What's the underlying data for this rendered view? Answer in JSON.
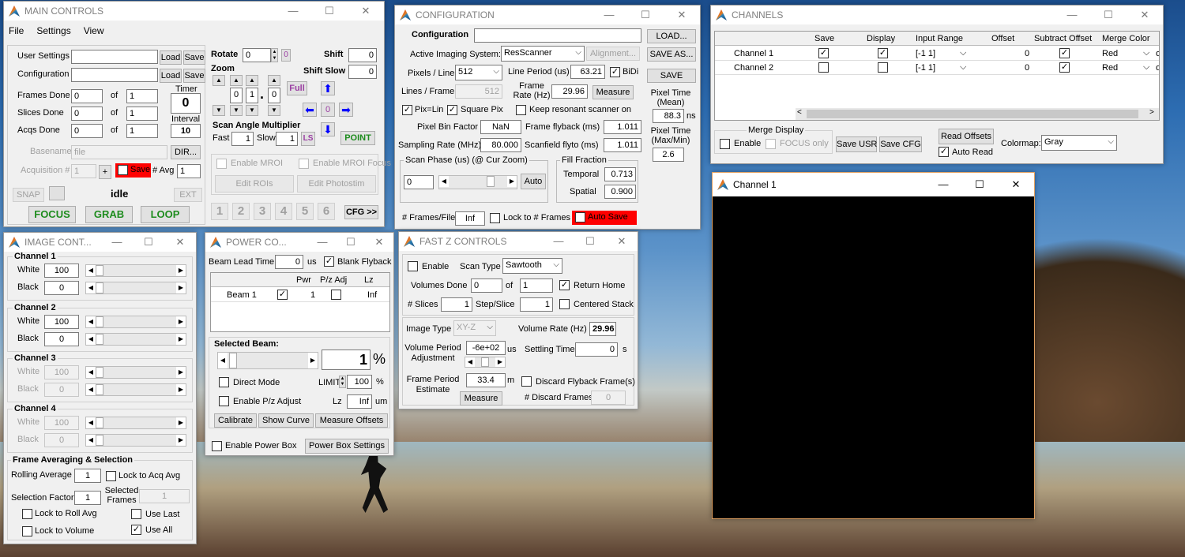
{
  "main": {
    "title": "MAIN CONTROLS",
    "menu": [
      "File",
      "Settings",
      "View"
    ],
    "user_settings": "User Settings",
    "configuration": "Configuration",
    "load": "Load",
    "save": "Save",
    "frames_done": "Frames Done",
    "slices_done": "Slices Done",
    "acqs_done": "Acqs Done",
    "of": "of",
    "frames_val": "0",
    "frames_of": "1",
    "slices_val": "0",
    "slices_of": "1",
    "acqs_val": "0",
    "acqs_of": "1",
    "timer": "Timer",
    "timer_val": "0",
    "interval": "Interval",
    "interval_val": "10",
    "basename": "Basename",
    "basename_val": "file",
    "dir": "DIR...",
    "acq_num": "Acquisition #",
    "acq_num_val": "1",
    "plus": "+",
    "save_red": "Save",
    "avg": "# Avg",
    "avg_val": "1",
    "snap": "SNAP",
    "status": "idle",
    "ext": "EXT",
    "focus": "FOCUS",
    "grab": "GRAB",
    "loop": "LOOP",
    "rotate": "Rotate",
    "rotate_val": "0",
    "zero": "0",
    "zoom": "Zoom",
    "shift": "Shift",
    "shift_val": "0",
    "shift_slow": "Shift Slow",
    "shift_slow_val": "0",
    "zoom_d1": "0",
    "zoom_d2": "1",
    "zoom_dot": ".",
    "zoom_d3": "0",
    "full": "Full",
    "center": "0",
    "scan_angle": "Scan Angle Multiplier",
    "fast": "Fast",
    "fast_val": "1",
    "slow": "Slow",
    "slow_val": "1",
    "ls": "LS",
    "point": "POINT",
    "enable_mroi": "Enable MROI",
    "enable_mroi_focus": "Enable MROI Focus",
    "edit_rois": "Edit ROIs",
    "edit_photostim": "Edit Photostim",
    "nums": [
      "1",
      "2",
      "3",
      "4",
      "5",
      "6"
    ],
    "cfg": "CFG >>"
  },
  "config": {
    "title": "CONFIGURATION",
    "configuration": "Configuration",
    "load": "LOAD...",
    "save_as": "SAVE AS...",
    "save": "SAVE",
    "active_sys": "Active Imaging System:",
    "active_sys_val": "ResScanner",
    "alignment": "Alignment...",
    "pixels_line": "Pixels / Line",
    "pixels_line_val": "512",
    "line_period": "Line Period (us)",
    "line_period_val": "63.21",
    "bidi": "BiDi",
    "lines_frame": "Lines / Frame",
    "lines_frame_val": "512",
    "frame_rate": "Frame Rate (Hz)",
    "frame_rate_val": "29.96",
    "measure": "Measure",
    "pixlin": "Pix=Lin",
    "square": "Square Pix",
    "keep_res": "Keep resonant scanner on",
    "pixel_time_mean": "Pixel Time (Mean)",
    "pixel_time_mean_val": "88.3",
    "ns": "ns",
    "pixel_time_maxmin": "Pixel Time (Max/Min)",
    "pixel_time_maxmin_val": "2.6",
    "pixel_bin": "Pixel Bin Factor",
    "pixel_bin_val": "NaN",
    "frame_flyback": "Frame flyback (ms)",
    "frame_flyback_val": "1.011",
    "sampling": "Sampling Rate (MHz)",
    "sampling_val": "80.000",
    "scanfield": "Scanfield flyto (ms)",
    "scanfield_val": "1.011",
    "scan_phase": "Scan Phase (us) (@ Cur Zoom)",
    "scan_phase_val": "0",
    "auto": "Auto",
    "fill_fraction": "Fill Fraction",
    "temporal": "Temporal",
    "temporal_val": "0.713",
    "spatial": "Spatial",
    "spatial_val": "0.900",
    "frames_file": "# Frames/File",
    "frames_file_val": "Inf",
    "lock_frames": "Lock to # Frames",
    "auto_save": "Auto Save"
  },
  "channels": {
    "title": "CHANNELS",
    "headers": [
      "Save",
      "Display",
      "Input Range",
      "Offset",
      "Subtract Offset",
      "Merge Color"
    ],
    "rows": [
      {
        "name": "Channel 1",
        "save": true,
        "display": true,
        "range": "[-1 1]",
        "offset": "0",
        "subtract": true,
        "color": "Red"
      },
      {
        "name": "Channel 2",
        "save": false,
        "display": false,
        "range": "[-1 1]",
        "offset": "0",
        "subtract": true,
        "color": "Red"
      }
    ],
    "merge_display": "Merge Display",
    "enable": "Enable",
    "focus_only": "FOCUS only",
    "save_usr": "Save USR",
    "save_cfg": "Save CFG",
    "read_offsets": "Read Offsets",
    "auto_read": "Auto Read",
    "colormap": "Colormap:",
    "colormap_val": "Gray",
    "overflow": "o"
  },
  "ch1win": {
    "title": "Channel 1"
  },
  "image": {
    "title": "IMAGE CONT...",
    "white": "White",
    "black": "Black",
    "channels": [
      {
        "name": "Channel 1",
        "white": "100",
        "black": "0",
        "enabled": true
      },
      {
        "name": "Channel 2",
        "white": "100",
        "black": "0",
        "enabled": true
      },
      {
        "name": "Channel 3",
        "white": "100",
        "black": "0",
        "enabled": false
      },
      {
        "name": "Channel 4",
        "white": "100",
        "black": "0",
        "enabled": false
      }
    ],
    "frame_avg": "Frame Averaging & Selection",
    "rolling": "Rolling Average",
    "rolling_val": "1",
    "lock_acq": "Lock to Acq Avg",
    "sel_factor": "Selection Factor",
    "sel_factor_val": "1",
    "sel_frames": "Selected Frames",
    "sel_frames_val": "1",
    "lock_roll": "Lock to Roll Avg",
    "use_last": "Use Last",
    "lock_vol": "Lock to Volume",
    "use_all": "Use All"
  },
  "power": {
    "title": "POWER CO...",
    "beam_lead": "Beam Lead Time:",
    "beam_lead_val": "0",
    "us": "us",
    "blank_flyback": "Blank Flyback",
    "headers": [
      "Pwr",
      "P/z Adj",
      "Lz"
    ],
    "beam": "Beam 1",
    "beam_pwr": "1",
    "beam_lz": "Inf",
    "selected_beam": "Selected Beam:",
    "pct_val": "1",
    "pct": "%",
    "direct": "Direct Mode",
    "limit": "LIMIT",
    "limit_val": "100",
    "enable_pz": "Enable P/z Adjust",
    "lz": "Lz",
    "lz_val": "Inf",
    "um": "um",
    "calibrate": "Calibrate",
    "show_curve": "Show Curve",
    "measure_offsets": "Measure Offsets",
    "enable_pb": "Enable Power Box",
    "pb_settings": "Power Box Settings"
  },
  "fastz": {
    "title": "FAST Z CONTROLS",
    "enable": "Enable",
    "scan_type": "Scan Type",
    "scan_type_val": "Sawtooth",
    "volumes_done": "Volumes Done",
    "volumes_val": "0",
    "of": "of",
    "volumes_of": "1",
    "return_home": "Return Home",
    "slices": "# Slices",
    "slices_val": "1",
    "step": "Step/Slice",
    "step_val": "1",
    "centered": "Centered Stack",
    "image_type": "Image Type",
    "image_type_val": "XY-Z",
    "volume_rate": "Volume Rate (Hz)",
    "volume_rate_val": "29.96",
    "vol_period": "Volume Period Adjustment",
    "vol_period_val": "-6e+02",
    "us": "us",
    "settling": "Settling Time",
    "settling_val": "0",
    "s": "s",
    "frame_period": "Frame Period Estimate",
    "frame_period_val": "33.4",
    "m": "m",
    "discard": "Discard Flyback Frame(s)",
    "discard_frames": "# Discard Frames",
    "discard_val": "0",
    "measure": "Measure"
  },
  "colors": {
    "red": "#ff0000",
    "green": "#1e8c1e",
    "blue": "#0000ff",
    "purple": "#9b3fa3"
  }
}
